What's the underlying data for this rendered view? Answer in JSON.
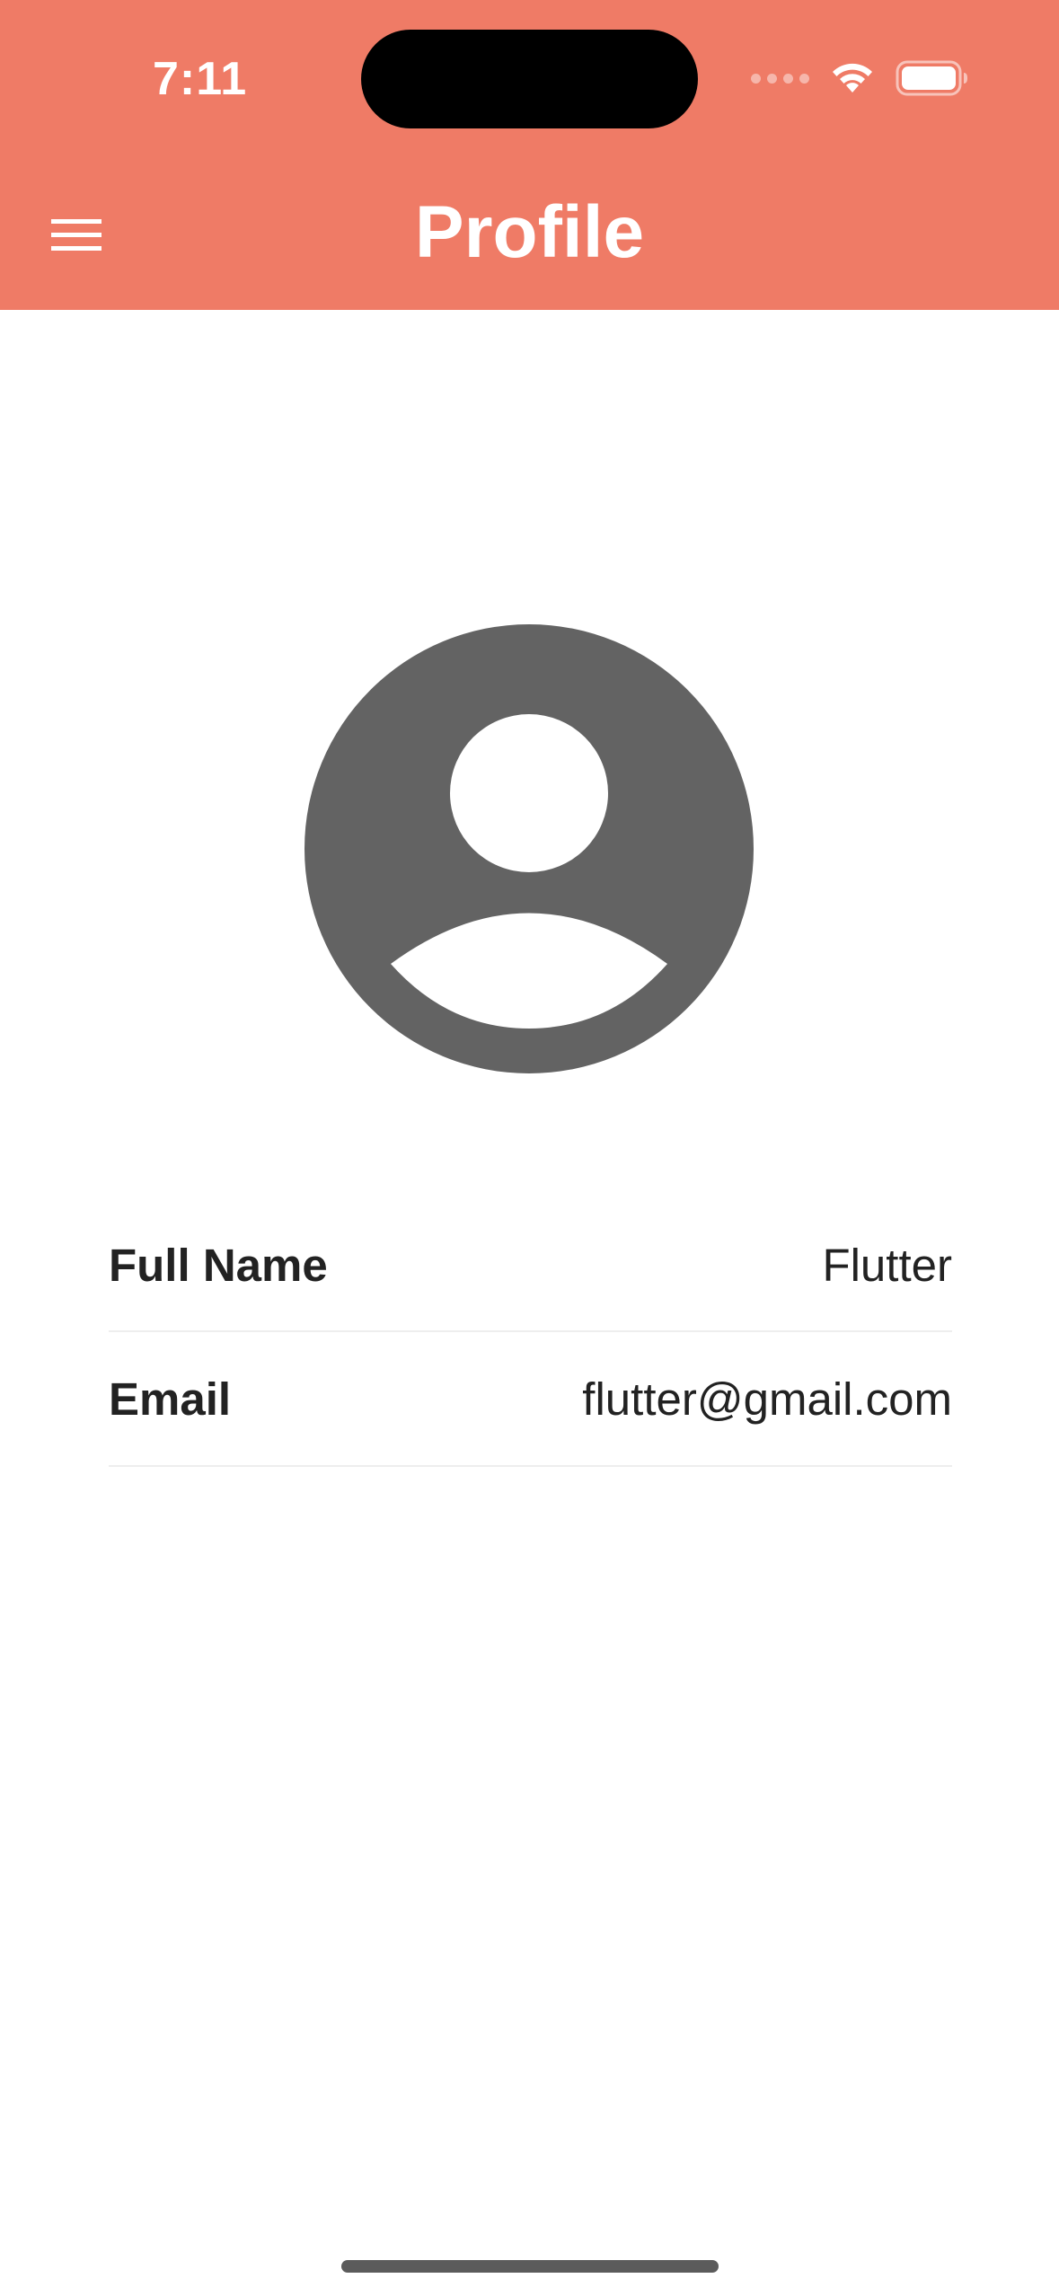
{
  "status_bar": {
    "time": "7:11"
  },
  "header": {
    "title": "Profile",
    "menu_icon": "hamburger-menu-icon",
    "background": "#EF7B66"
  },
  "avatar": {
    "icon": "account-circle-icon",
    "color": "#636363"
  },
  "profile": {
    "rows": [
      {
        "label": "Full Name",
        "value": "Flutter"
      },
      {
        "label": "Email",
        "value": "flutter@gmail.com"
      }
    ]
  }
}
